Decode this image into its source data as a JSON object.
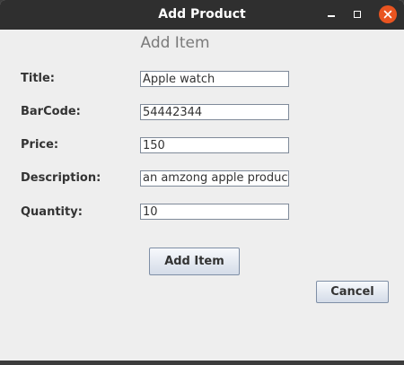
{
  "window": {
    "title": "Add Product",
    "controls": {
      "minimize_icon": "minimize-icon",
      "maximize_icon": "maximize-icon",
      "close_icon": "close-icon",
      "close_color": "#e95420"
    }
  },
  "form": {
    "heading": "Add Item",
    "fields": [
      {
        "label": "Title:",
        "value": "Apple watch"
      },
      {
        "label": "BarCode:",
        "value": "54442344"
      },
      {
        "label": "Price:",
        "value": "150"
      },
      {
        "label": "Description:",
        "value": "an amzong apple product."
      },
      {
        "label": "Quantity:",
        "value": "10"
      }
    ]
  },
  "buttons": {
    "add_label": "Add Item",
    "cancel_label": "Cancel"
  }
}
